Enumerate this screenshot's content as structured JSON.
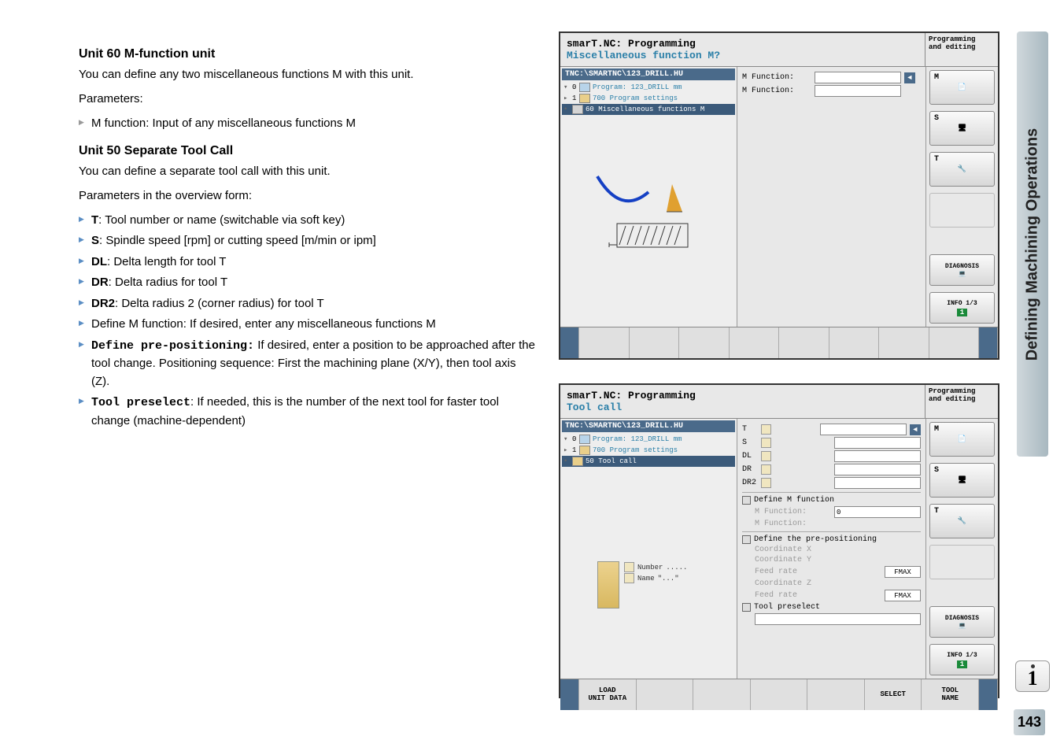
{
  "vertical_title": "Defining Machining Operations",
  "page_number": "143",
  "section1": {
    "heading": "Unit 60 M-function unit",
    "text": "You can define any two miscellaneous functions M with this unit.",
    "params_label": "Parameters:",
    "bullet1": "M function: Input of any miscellaneous functions M"
  },
  "section2": {
    "heading": "Unit 50 Separate Tool Call",
    "text": "You can define a separate tool call with this unit.",
    "params_label": "Parameters in the overview form:",
    "bullets": [
      {
        "key": "T",
        "desc": ": Tool number or name (switchable via soft key)"
      },
      {
        "key": "S",
        "desc": ": Spindle speed [rpm] or cutting speed [m/min or ipm]"
      },
      {
        "key": "DL",
        "desc": ": Delta length for tool T"
      },
      {
        "key": "DR",
        "desc": ": Delta radius for tool T"
      },
      {
        "key": "DR2",
        "desc": ": Delta radius 2 (corner radius) for tool T"
      }
    ],
    "define_m": "Define M function: If desired, enter any miscellaneous functions M",
    "define_pre_key": "Define pre-positioning:",
    "define_pre_desc": " If desired, enter a position to be approached after the tool change. Positioning sequence: First the machining plane (X/Y), then tool axis (Z).",
    "tool_pre_key": "Tool preselect",
    "tool_pre_desc": ": If needed, this is the number of the next tool for faster tool change (machine-dependent)"
  },
  "ss1": {
    "title": "smarT.NC: Programming",
    "subtitle": "Miscellaneous function M?",
    "mode_l1": "Programming",
    "mode_l2": "and editing",
    "tree_header": "TNC:\\SMARTNC\\123_DRILL.HU",
    "tree_items": [
      "Program: 123_DRILL mm",
      "700 Program settings",
      "60 Miscellaneous functions M"
    ],
    "form": {
      "l1": "M Function:",
      "l2": "M Function:"
    },
    "side": {
      "m": "M",
      "s": "S",
      "t": "T",
      "diag": "DIAGNOSIS",
      "info": "INFO 1/3",
      "info_badge": "1"
    }
  },
  "ss2": {
    "title": "smarT.NC: Programming",
    "subtitle": "Tool call",
    "mode_l1": "Programming",
    "mode_l2": "and editing",
    "tree_header": "TNC:\\SMARTNC\\123_DRILL.HU",
    "tree_items": [
      "Program: 123_DRILL mm",
      "700 Program settings",
      "50 Tool call"
    ],
    "tool_preview": {
      "number_lbl": "Number",
      "number_val": ".....",
      "name_lbl": "Name",
      "name_val": "\"...\""
    },
    "form": {
      "t": "T",
      "s": "S",
      "dl": "DL",
      "dr": "DR",
      "dr2": "DR2",
      "define_m": "Define M function",
      "mfun1": "M Function:",
      "mfun1_val": "0",
      "mfun2": "M Function:",
      "define_pre": "Define the pre-positioning",
      "coordx": "Coordinate X",
      "coordy": "Coordinate Y",
      "feed1": "Feed rate",
      "fmax": "FMAX",
      "coordz": "Coordinate Z",
      "feed2": "Feed rate",
      "tool_pre": "Tool preselect"
    },
    "side": {
      "m": "M",
      "s": "S",
      "t": "T",
      "diag": "DIAGNOSIS",
      "info": "INFO 1/3",
      "info_badge": "1"
    },
    "softkeys": {
      "sk1": "LOAD\nUNIT DATA",
      "sk5": "SELECT",
      "sk6": "TOOL\nNAME"
    }
  }
}
